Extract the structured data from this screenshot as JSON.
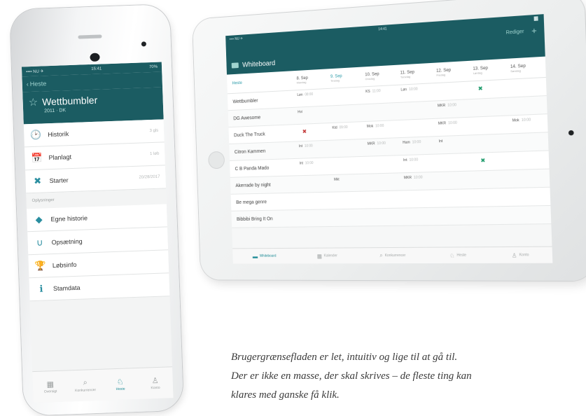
{
  "phone": {
    "status": {
      "carrier": "•••• NU ✈",
      "time": "15:41",
      "battery": "70%"
    },
    "nav": {
      "back_label": "Heste"
    },
    "hero": {
      "title": "Wettbumbler",
      "subtitle": "2011 · DK"
    },
    "rows": [
      {
        "icon": "history-icon",
        "glyph": "🕑",
        "label": "Historik",
        "value": "3 gls"
      },
      {
        "icon": "calendar-icon",
        "glyph": "📅",
        "label": "Planlagt",
        "value": "1 løb"
      },
      {
        "icon": "checkered-flag-icon",
        "glyph": "✖",
        "label": "Starter",
        "value": "20/28/2017"
      }
    ],
    "section_label": "Oplysninger",
    "rows2": [
      {
        "icon": "tag-icon",
        "glyph": "◆",
        "label": "Egne historie"
      },
      {
        "icon": "horseshoe-icon",
        "glyph": "∪",
        "label": "Opsætning"
      },
      {
        "icon": "trophy-icon",
        "glyph": "🏆",
        "label": "Løbsinfo"
      },
      {
        "icon": "info-icon",
        "glyph": "ℹ",
        "label": "Stamdata"
      }
    ],
    "tabs": [
      {
        "icon": "calendar-icon",
        "glyph": "▦",
        "label": "Oversigt"
      },
      {
        "icon": "search-icon",
        "glyph": "⌕",
        "label": "Konkurrencer"
      },
      {
        "icon": "horse-icon",
        "glyph": "♘",
        "label": "Heste"
      },
      {
        "icon": "person-icon",
        "glyph": "♙",
        "label": "Konto"
      }
    ]
  },
  "tablet": {
    "status": {
      "carrier": "•••• NU ✈",
      "time": "14:41",
      "battery": "█▌"
    },
    "nav": {
      "right_label": "Rediger",
      "plus": "+"
    },
    "title": "Whiteboard",
    "corner_label": "Heste",
    "days": [
      {
        "date": "8. Sep",
        "weekday": "Mandag"
      },
      {
        "date": "9. Sep",
        "weekday": "Tirsdag",
        "today": true
      },
      {
        "date": "10. Sep",
        "weekday": "Onsdag"
      },
      {
        "date": "11. Sep",
        "weekday": "Torsdag"
      },
      {
        "date": "12. Sep",
        "weekday": "Fredag"
      },
      {
        "date": "13. Sep",
        "weekday": "Lørdag"
      },
      {
        "date": "14. Sep",
        "weekday": "Søndag"
      }
    ],
    "horses": [
      {
        "name": "Wettbumbler",
        "cells": [
          {
            "t": "Løn",
            "tm": "08:00"
          },
          null,
          {
            "t": "KS",
            "tm": "11:00"
          },
          {
            "t": "Løn",
            "tm": "10:00"
          },
          null,
          {
            "flag": "green"
          },
          null
        ]
      },
      {
        "name": "DG Awesome",
        "cells": [
          {
            "t": "Hvi"
          },
          null,
          null,
          null,
          {
            "t": "MKR",
            "tm": "10:00"
          },
          null,
          null
        ]
      },
      {
        "name": "Duck The Truck",
        "cells": [
          {
            "flag": "red"
          },
          {
            "t": "Ktd",
            "tm": "09:00"
          },
          {
            "t": "Mok",
            "tm": "10:00"
          },
          null,
          {
            "t": "MKR",
            "tm": "10:00"
          },
          null,
          {
            "t": "Mok",
            "tm": "10:00"
          }
        ]
      },
      {
        "name": "Citron Kammen",
        "cells": [
          {
            "t": "Int",
            "tm": "10:00"
          },
          null,
          {
            "t": "MKR",
            "tm": "10:00"
          },
          {
            "t": "Ham",
            "tm": "10:00"
          },
          {
            "t": "Int"
          },
          null,
          null
        ]
      },
      {
        "name": "C B Panda Mado",
        "cells": [
          {
            "t": "Int",
            "tm": "10:00"
          },
          null,
          null,
          {
            "t": "Int",
            "tm": "10:00"
          },
          null,
          {
            "flag": "green"
          },
          null
        ]
      },
      {
        "name": "Akerrade by night",
        "cells": [
          null,
          {
            "t": "Mkt"
          },
          null,
          {
            "t": "MKR",
            "tm": "10:00"
          },
          null,
          null,
          null
        ]
      },
      {
        "name": "Be mega genre",
        "cells": [
          null,
          null,
          null,
          null,
          null,
          null,
          null
        ]
      },
      {
        "name": "Bibbibi Bring It On",
        "cells": [
          null,
          null,
          null,
          null,
          null,
          null,
          null
        ]
      }
    ],
    "tabs": [
      {
        "icon": "whiteboard-icon",
        "glyph": "▬",
        "label": "Whiteboard",
        "active": true
      },
      {
        "icon": "calendar-icon",
        "glyph": "▦",
        "label": "Kalender"
      },
      {
        "icon": "search-icon",
        "glyph": "⌕",
        "label": "Konkurrencer"
      },
      {
        "icon": "horse-icon",
        "glyph": "♘",
        "label": "Heste"
      },
      {
        "icon": "person-icon",
        "glyph": "♙",
        "label": "Konto"
      }
    ]
  },
  "caption": {
    "line1": "Brugergrænsefladen er let, intuitiv og lige til at gå til.",
    "line2": "Der er ikke en masse, der skal skrives – de fleste ting kan",
    "line3": "klares med ganske få klik."
  }
}
